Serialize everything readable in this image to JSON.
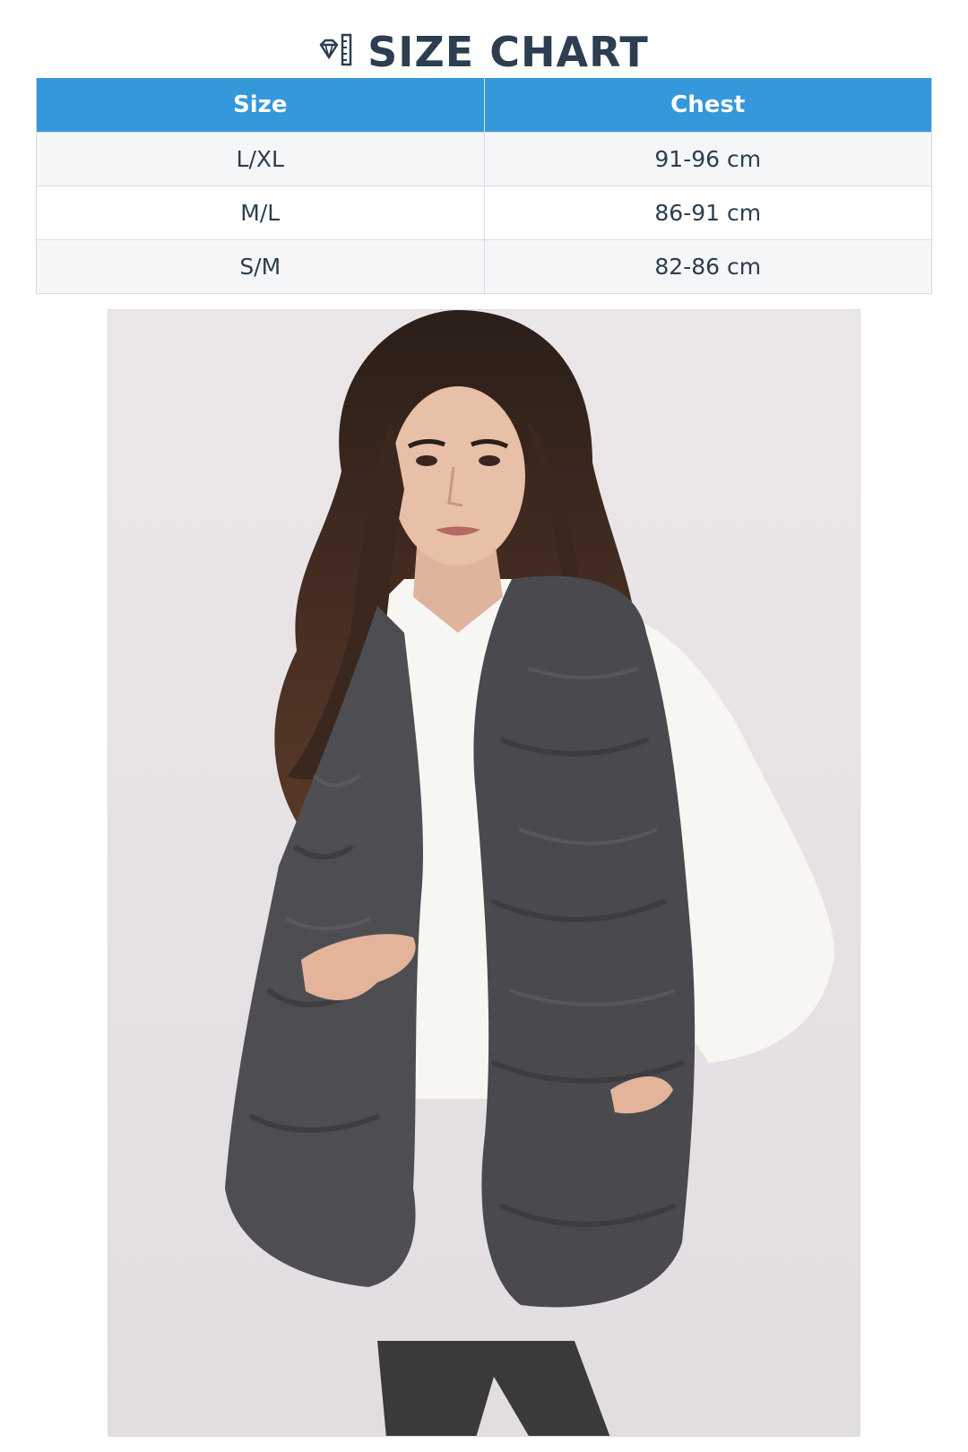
{
  "header": {
    "title": "SIZE CHART",
    "icon": "diamond-ruler-icon"
  },
  "table": {
    "columns": [
      "Size",
      "Chest"
    ],
    "rows": [
      {
        "size": "L/XL",
        "chest": "91-96 cm"
      },
      {
        "size": "M/L",
        "chest": "86-91 cm"
      },
      {
        "size": "S/M",
        "chest": "82-86 cm"
      }
    ]
  },
  "colors": {
    "header_bg": "#3498db",
    "title_text": "#2c3e50",
    "row_alt_bg": "#f4f6f8"
  }
}
